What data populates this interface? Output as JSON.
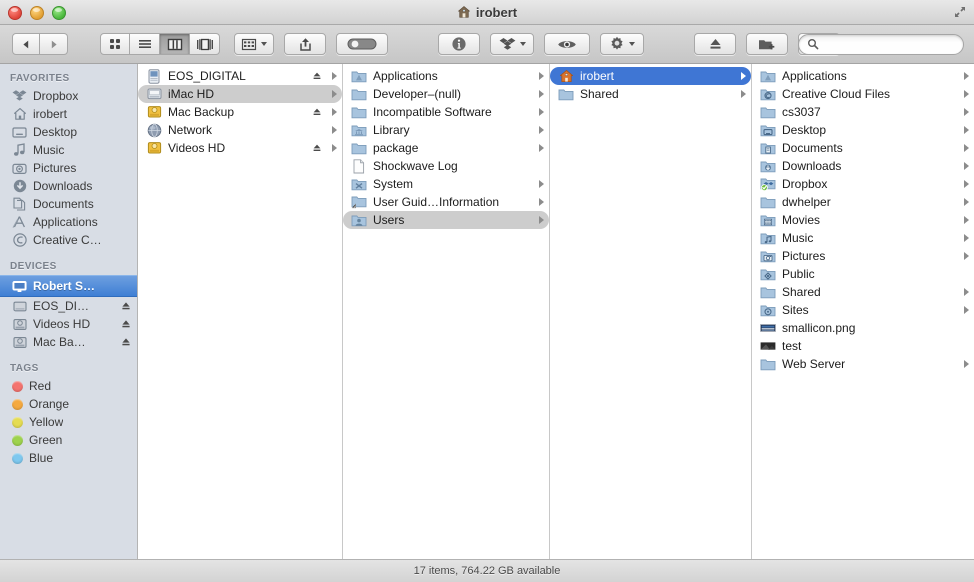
{
  "window": {
    "title": "irobert",
    "title_icon": "home-icon",
    "traffic_lights": [
      "close-button",
      "minimize-button",
      "zoom-button"
    ],
    "fullscreen_icon": "fullscreen-arrows-icon"
  },
  "toolbar": {
    "nav": [
      {
        "name": "back-button",
        "icon": "chevron-left-icon"
      },
      {
        "name": "forward-button",
        "icon": "chevron-right-icon"
      }
    ],
    "views": [
      {
        "name": "icon-view-button",
        "icon": "grid-icon",
        "active": false
      },
      {
        "name": "list-view-button",
        "icon": "list-icon",
        "active": false
      },
      {
        "name": "column-view-button",
        "icon": "columns-icon",
        "active": true
      },
      {
        "name": "coverflow-view-button",
        "icon": "coverflow-icon",
        "active": false
      }
    ],
    "actions": [
      {
        "name": "arrange-button",
        "icon": "arrange-grid-icon",
        "has_caret": true
      },
      {
        "name": "share-button",
        "icon": "share-arrow-icon",
        "has_caret": false
      },
      {
        "name": "tags-button",
        "icon": "tag-pill-icon",
        "has_caret": false
      },
      {
        "name": "info-button",
        "icon": "info-circle-icon",
        "has_caret": false
      },
      {
        "name": "dropbox-button",
        "icon": "dropbox-icon",
        "has_caret": true
      },
      {
        "name": "quicklook-button",
        "icon": "eye-icon",
        "has_caret": false
      },
      {
        "name": "action-button",
        "icon": "gear-icon",
        "has_caret": true
      },
      {
        "name": "eject-button",
        "icon": "eject-triangle-icon",
        "has_caret": false
      },
      {
        "name": "new-folder-button",
        "icon": "folder-plus-icon",
        "has_caret": false
      },
      {
        "name": "delete-button",
        "icon": "trash-icon",
        "has_caret": false
      }
    ],
    "search": {
      "placeholder": "",
      "value": "",
      "icon": "magnifier-icon"
    }
  },
  "sidebar": {
    "sections": [
      {
        "header": "FAVORITES",
        "items": [
          {
            "label": "Dropbox",
            "icon": "dropbox-icon",
            "eject": false,
            "selected": false
          },
          {
            "label": "irobert",
            "icon": "home-icon",
            "eject": false,
            "selected": false
          },
          {
            "label": "Desktop",
            "icon": "desktop-icon",
            "eject": false,
            "selected": false
          },
          {
            "label": "Music",
            "icon": "music-note-icon",
            "eject": false,
            "selected": false
          },
          {
            "label": "Pictures",
            "icon": "camera-icon",
            "eject": false,
            "selected": false
          },
          {
            "label": "Downloads",
            "icon": "download-icon",
            "eject": false,
            "selected": false
          },
          {
            "label": "Documents",
            "icon": "documents-icon",
            "eject": false,
            "selected": false
          },
          {
            "label": "Applications",
            "icon": "applications-icon",
            "eject": false,
            "selected": false
          },
          {
            "label": "Creative C…",
            "icon": "creative-cloud-icon",
            "eject": false,
            "selected": false
          }
        ]
      },
      {
        "header": "DEVICES",
        "items": [
          {
            "label": "Robert S…",
            "icon": "imac-display-icon",
            "eject": false,
            "selected": true
          },
          {
            "label": "EOS_DI…",
            "icon": "harddisk-icon",
            "eject": true,
            "selected": false
          },
          {
            "label": "Videos HD",
            "icon": "external-drive-icon",
            "eject": true,
            "selected": false
          },
          {
            "label": "Mac Ba…",
            "icon": "external-drive-icon",
            "eject": true,
            "selected": false
          }
        ]
      },
      {
        "header": "TAGS",
        "items": [
          {
            "label": "Red",
            "icon": "tag-dot-icon",
            "color": "#f4736f",
            "selected": false
          },
          {
            "label": "Orange",
            "icon": "tag-dot-icon",
            "color": "#f5a93f",
            "selected": false
          },
          {
            "label": "Yellow",
            "icon": "tag-dot-icon",
            "color": "#e5dc52",
            "selected": false
          },
          {
            "label": "Green",
            "icon": "tag-dot-icon",
            "color": "#9ed34e",
            "selected": false
          },
          {
            "label": "Blue",
            "icon": "tag-dot-icon",
            "color": "#7ec8ef",
            "selected": false
          }
        ]
      }
    ]
  },
  "columns": [
    {
      "name": "column-volumes",
      "items": [
        {
          "label": "EOS_DIGITAL",
          "icon": "camera-card-icon",
          "eject": true,
          "arrow": true,
          "selected": "none"
        },
        {
          "label": "iMac HD",
          "icon": "harddisk-icon",
          "eject": false,
          "arrow": true,
          "selected": "gray"
        },
        {
          "label": "Mac Backup",
          "icon": "external-drive-icon",
          "eject": true,
          "arrow": true,
          "selected": "none"
        },
        {
          "label": "Network",
          "icon": "network-globe-icon",
          "eject": false,
          "arrow": true,
          "selected": "none"
        },
        {
          "label": "Videos HD",
          "icon": "external-drive-icon",
          "eject": true,
          "arrow": true,
          "selected": "none"
        }
      ]
    },
    {
      "name": "column-imac-hd-root",
      "items": [
        {
          "label": "Applications",
          "icon": "applications-folder-icon",
          "arrow": true,
          "selected": "none"
        },
        {
          "label": "Developer–(null)",
          "icon": "folder-icon",
          "arrow": true,
          "selected": "none"
        },
        {
          "label": "Incompatible Software",
          "icon": "folder-icon",
          "arrow": true,
          "selected": "none"
        },
        {
          "label": "Library",
          "icon": "library-folder-icon",
          "arrow": true,
          "selected": "none"
        },
        {
          "label": "package",
          "icon": "folder-icon",
          "arrow": true,
          "selected": "none"
        },
        {
          "label": "Shockwave Log",
          "icon": "document-file-icon",
          "arrow": false,
          "selected": "none"
        },
        {
          "label": "System",
          "icon": "system-folder-icon",
          "arrow": true,
          "selected": "none"
        },
        {
          "label": "User Guid…Information",
          "icon": "alias-folder-icon",
          "arrow": true,
          "selected": "none"
        },
        {
          "label": "Users",
          "icon": "users-folder-icon",
          "arrow": true,
          "selected": "gray"
        }
      ]
    },
    {
      "name": "column-users",
      "items": [
        {
          "label": "irobert",
          "icon": "home-folder-icon",
          "arrow": true,
          "selected": "blue"
        },
        {
          "label": "Shared",
          "icon": "folder-icon",
          "arrow": true,
          "selected": "none"
        }
      ]
    },
    {
      "name": "column-home-irobert",
      "items": [
        {
          "label": "Applications",
          "icon": "applications-folder-icon",
          "arrow": true,
          "selected": "none"
        },
        {
          "label": "Creative Cloud Files",
          "icon": "creative-cloud-folder-icon",
          "arrow": true,
          "selected": "none"
        },
        {
          "label": "cs3037",
          "icon": "folder-icon",
          "arrow": true,
          "selected": "none"
        },
        {
          "label": "Desktop",
          "icon": "desktop-folder-icon",
          "arrow": true,
          "selected": "none"
        },
        {
          "label": "Documents",
          "icon": "documents-folder-icon",
          "arrow": true,
          "selected": "none"
        },
        {
          "label": "Downloads",
          "icon": "downloads-folder-icon",
          "arrow": true,
          "selected": "none"
        },
        {
          "label": "Dropbox",
          "icon": "dropbox-folder-icon",
          "arrow": true,
          "selected": "none"
        },
        {
          "label": "dwhelper",
          "icon": "folder-icon",
          "arrow": true,
          "selected": "none"
        },
        {
          "label": "Movies",
          "icon": "movies-folder-icon",
          "arrow": true,
          "selected": "none"
        },
        {
          "label": "Music",
          "icon": "music-folder-icon",
          "arrow": true,
          "selected": "none"
        },
        {
          "label": "Pictures",
          "icon": "pictures-folder-icon",
          "arrow": true,
          "selected": "none"
        },
        {
          "label": "Public",
          "icon": "public-folder-icon",
          "arrow": false,
          "selected": "none"
        },
        {
          "label": "Shared",
          "icon": "folder-icon",
          "arrow": true,
          "selected": "none"
        },
        {
          "label": "Sites",
          "icon": "sites-folder-icon",
          "arrow": true,
          "selected": "none"
        },
        {
          "label": "smallicon.png",
          "icon": "png-image-icon",
          "arrow": false,
          "selected": "none"
        },
        {
          "label": "test",
          "icon": "dark-image-icon",
          "arrow": false,
          "selected": "none"
        },
        {
          "label": "Web Server",
          "icon": "folder-icon",
          "arrow": true,
          "selected": "none"
        }
      ]
    }
  ],
  "statusbar": {
    "text": "17 items, 764.22 GB available"
  }
}
